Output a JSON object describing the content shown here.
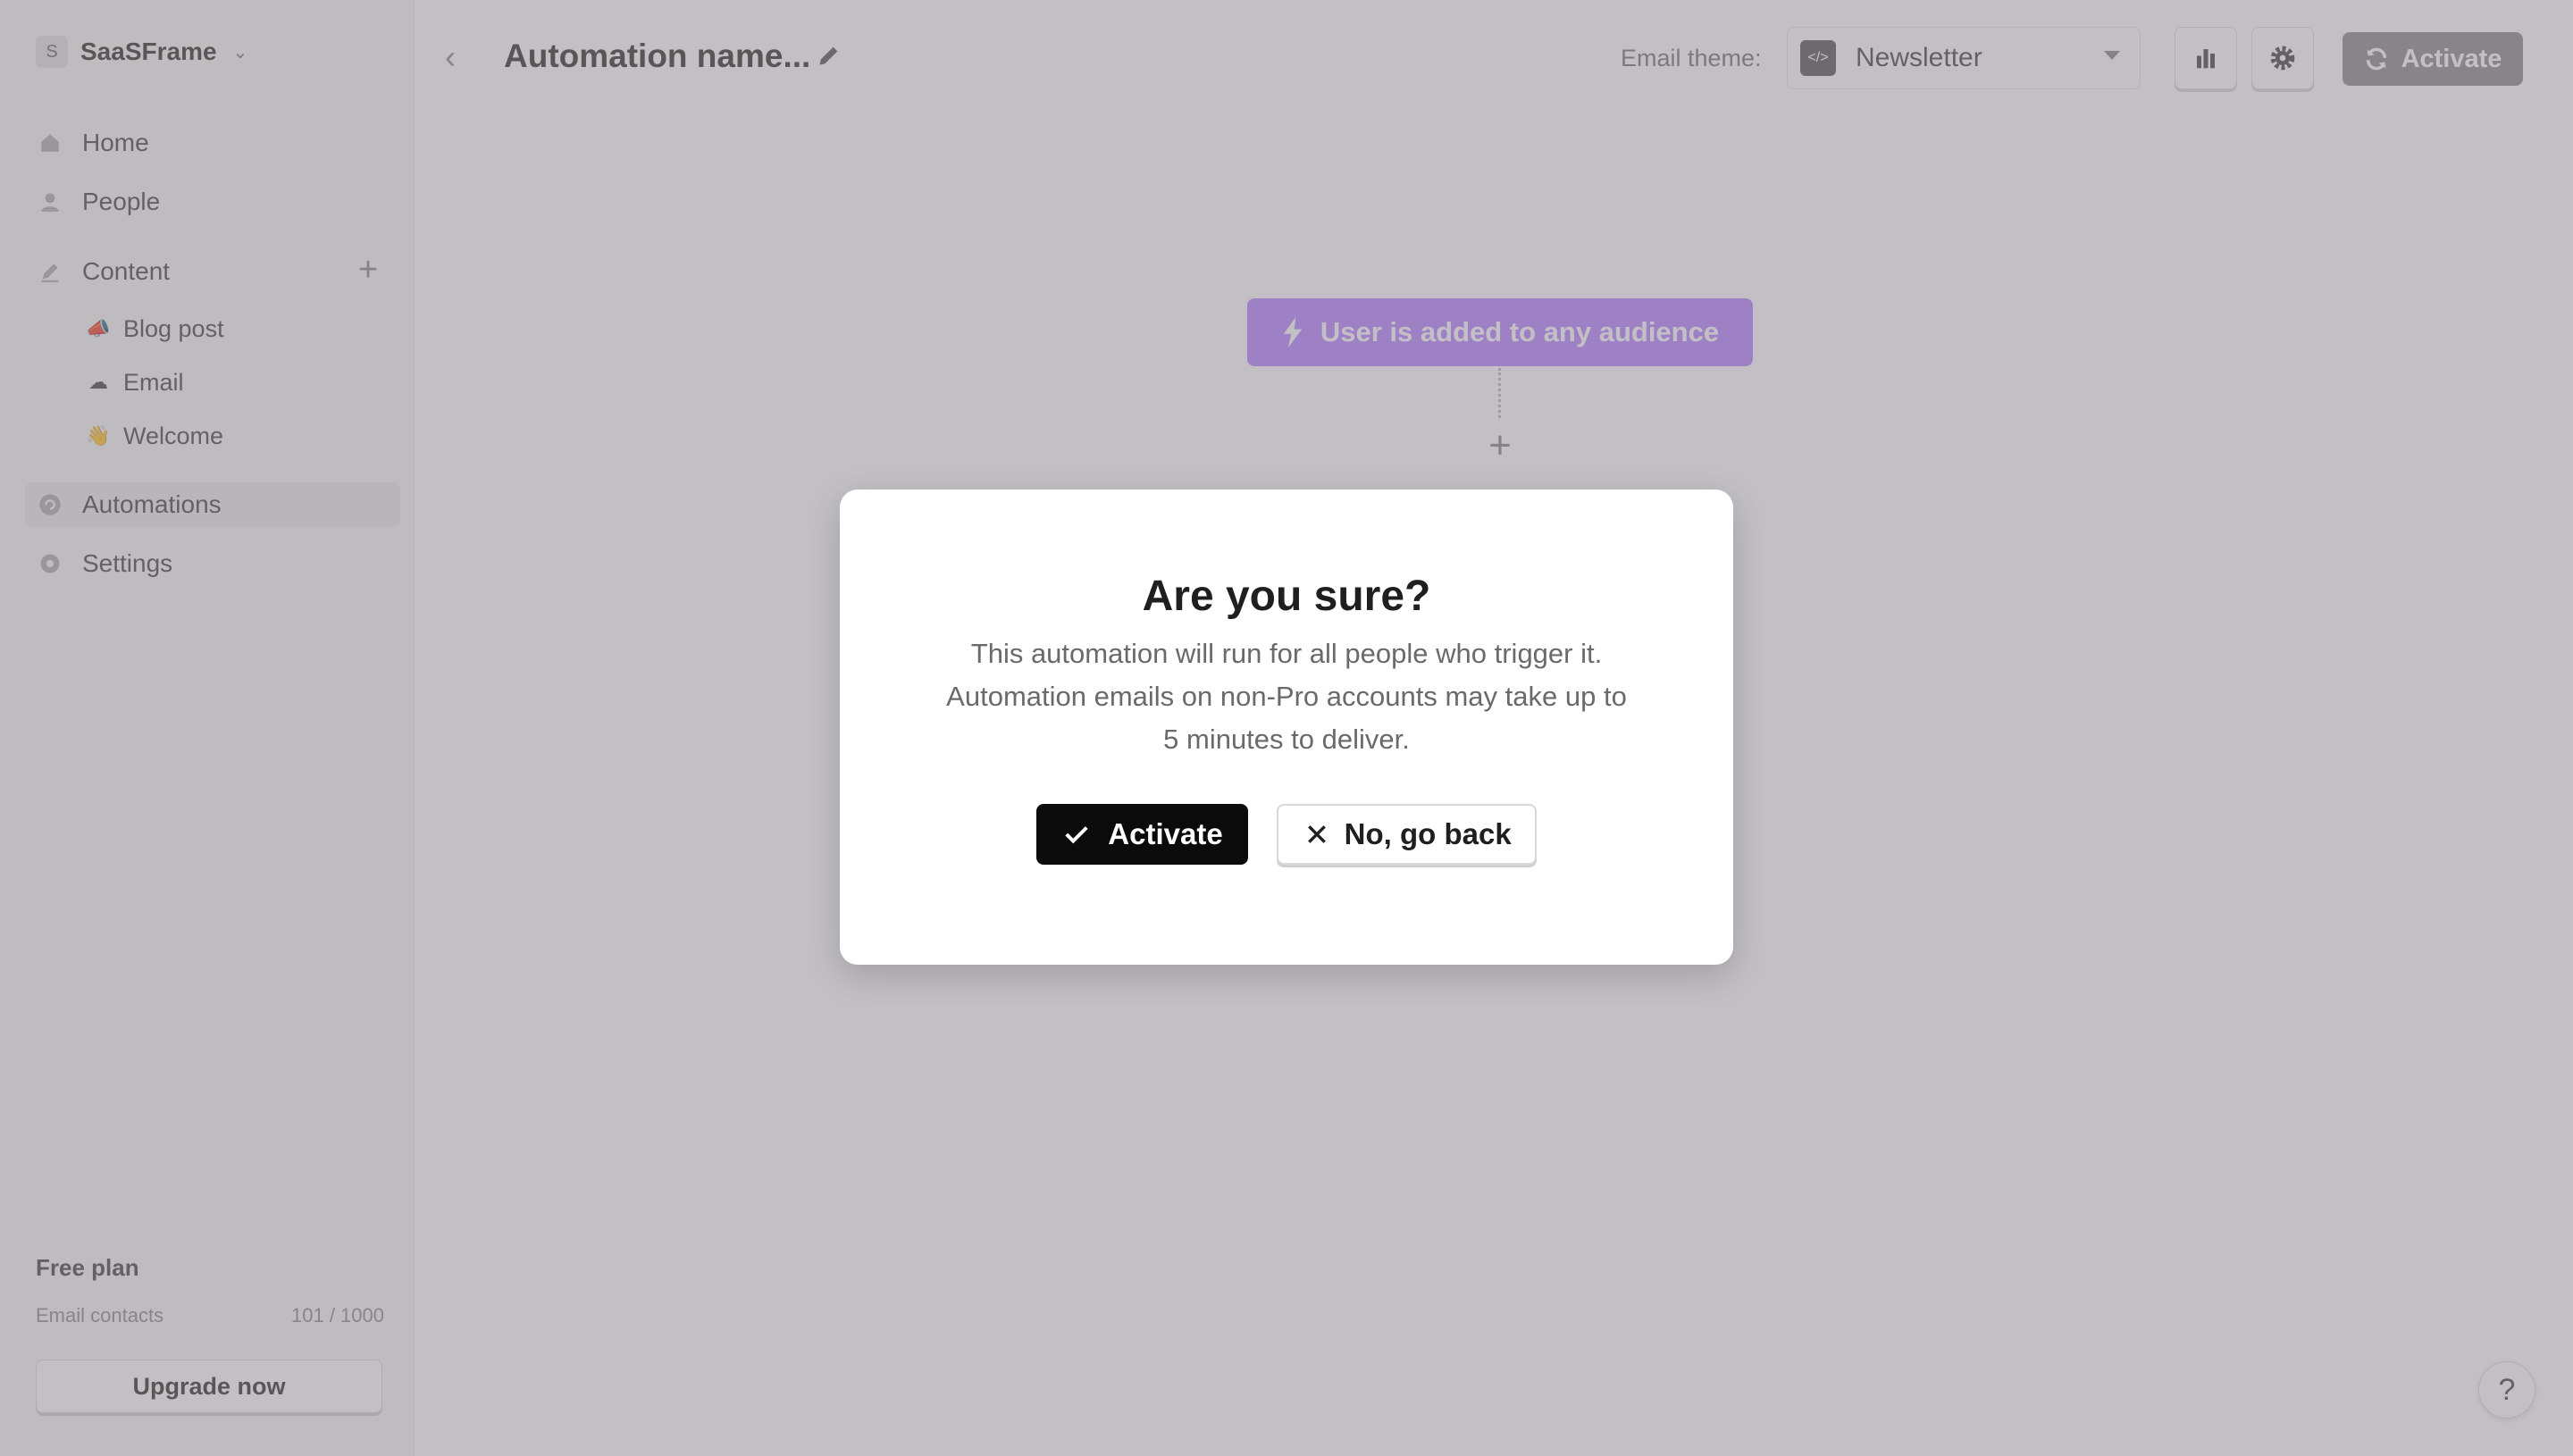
{
  "sidebar": {
    "workspace": {
      "initial": "S",
      "name": "SaaSFrame"
    },
    "nav": [
      {
        "label": "Home",
        "icon": "home-icon"
      },
      {
        "label": "People",
        "icon": "person-icon"
      }
    ],
    "content": {
      "label": "Content",
      "icon": "pen-icon",
      "items": [
        {
          "label": "Blog post",
          "icon": "megaphone-emoji-icon"
        },
        {
          "label": "Email",
          "icon": "cloud-emoji-icon"
        },
        {
          "label": "Welcome",
          "icon": "wave-emoji-icon"
        }
      ]
    },
    "automations": {
      "label": "Automations",
      "icon": "automation-icon"
    },
    "settings": {
      "label": "Settings",
      "icon": "gear-icon"
    },
    "plan": {
      "name": "Free plan",
      "contacts_label": "Email contacts",
      "contacts_count": "101 / 1000",
      "upgrade_label": "Upgrade now"
    }
  },
  "header": {
    "title": "Automation name...",
    "theme_label": "Email theme:",
    "theme_value": "Newsletter",
    "theme_badge": "</>",
    "activate_label": "Activate"
  },
  "canvas": {
    "trigger_label": "User is added to any audience"
  },
  "modal": {
    "title": "Are you sure?",
    "body_line1": "This automation will run for all people who trigger it.",
    "body_line2": "Automation emails on non-Pro accounts may take up to",
    "body_line3": "5 minutes to deliver.",
    "confirm_label": "Activate",
    "cancel_label": "No, go back"
  },
  "help": {
    "label": "?"
  },
  "colors": {
    "trigger": "#b987ff",
    "overlay": "rgba(130,124,134,0.48)",
    "confirm_button": "#0b0b0b",
    "top_activate": "#8f8f8f"
  }
}
